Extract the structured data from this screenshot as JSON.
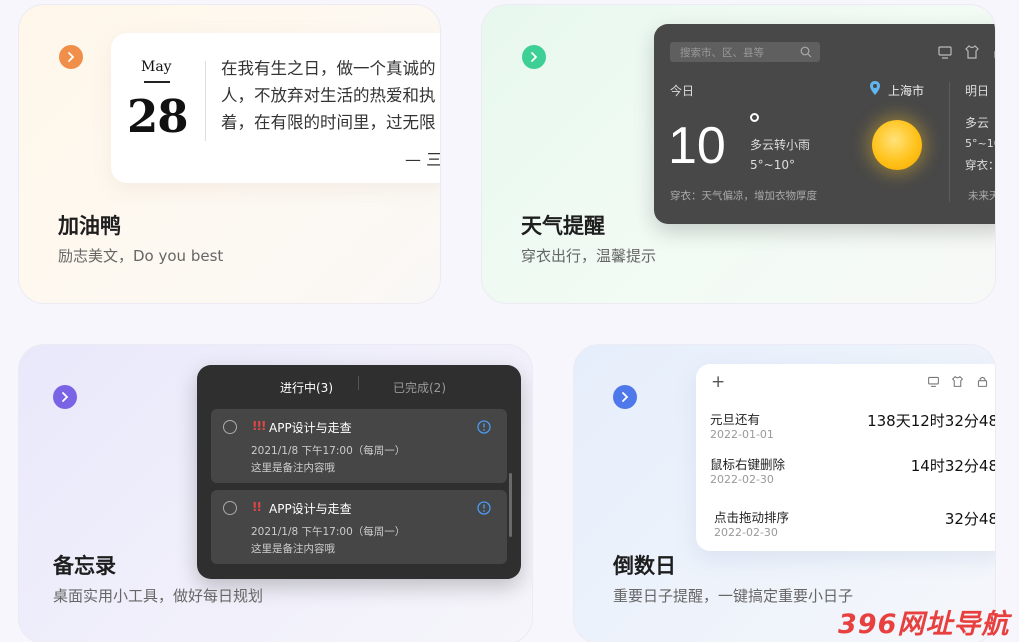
{
  "quote_card": {
    "title": "加油鸭",
    "subtitle": "励志美文，Do you best",
    "accent": "#f08f4a",
    "widget": {
      "month": "May",
      "day": "28",
      "lines": [
        "在我有生之日，做一个真诚的",
        "人，不放弃对生活的热爱和执",
        "着，在有限的时间里，过无限"
      ],
      "author": "— 三"
    }
  },
  "weather_card": {
    "title": "天气提醒",
    "subtitle": "穿衣出行，温馨提示",
    "accent": "#3dcf94",
    "widget": {
      "search_placeholder": "搜索市、区、县等",
      "today_label": "今日",
      "temperature": "10",
      "condition": "多云转小雨",
      "range": "5°~10°",
      "city": "上海市",
      "clothing_advice": "穿衣：天气偏凉，增加衣物厚度",
      "tomorrow_label": "明日",
      "tomorrow_condition": "多云",
      "tomorrow_range": "5°~10",
      "tomorrow_clothing": "穿衣：",
      "future_label": "未来天"
    }
  },
  "memo_card": {
    "title": "备忘录",
    "subtitle": "桌面实用小工具，做好每日规划",
    "accent": "#7b63e6",
    "widget": {
      "tab_active": "进行中(3)",
      "tab_inactive": "已完成(2)",
      "items": [
        {
          "priority": "!!!",
          "title": "APP设计与走查",
          "time": "2021/1/8 下午17:00（每周一）",
          "note": "这里是备注内容哦"
        },
        {
          "priority": "!!",
          "title": "APP设计与走查",
          "time": "2021/1/8 下午17:00（每周一）",
          "note": "这里是备注内容哦"
        }
      ]
    }
  },
  "countdown_card": {
    "title": "倒数日",
    "subtitle": "重要日子提醒，一键搞定重要小日子",
    "accent": "#4f78ea",
    "widget": {
      "add_label": "+",
      "items": [
        {
          "name": "元旦还有",
          "date": "2022-01-01",
          "remaining": "138天12时32分48"
        },
        {
          "name": "鼠标右键删除",
          "date": "2022-02-30",
          "remaining": "14时32分48"
        },
        {
          "name": "点击拖动排序",
          "date": "2022-02-30",
          "remaining": "32分48"
        }
      ]
    }
  },
  "watermark": "396网址导航"
}
